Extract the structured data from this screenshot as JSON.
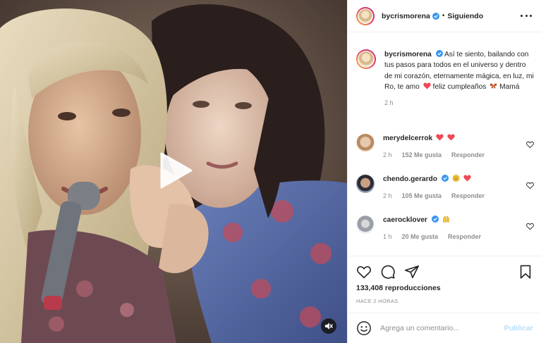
{
  "post": {
    "username": "bycrismorena",
    "follow_label": "Siguiendo",
    "separator": "•",
    "caption_text": "Así te siento, bailando con tus pasos para todos en el universo y dentro de mi corazón, eternamente mágica, en luz, mi Ro, te amo",
    "caption_text_2": "feliz cumpleaños",
    "caption_text_3": "Mamá",
    "caption_time": "2 h",
    "views": "133,408 reproducciones",
    "posted_ago": "HACE 2 HORAS"
  },
  "comments": [
    {
      "username": "merydelcerrok",
      "time": "2 h",
      "likes": "152 Me gusta",
      "reply": "Responder",
      "verified": false
    },
    {
      "username": "chendo.gerardo",
      "time": "2 h",
      "likes": "105 Me gusta",
      "reply": "Responder",
      "verified": true
    },
    {
      "username": "caerocklover",
      "time": "1 h",
      "likes": "20 Me gusta",
      "reply": "Responder",
      "verified": true
    }
  ],
  "add_comment": {
    "placeholder": "Agrega un comentario...",
    "publish_label": "Publicar"
  },
  "icons": {
    "like": "heart-icon",
    "comment": "comment-icon",
    "share": "share-icon",
    "save": "bookmark-icon",
    "emoji": "smile-icon",
    "mute": "speaker-muted-icon",
    "play": "play-icon",
    "more": "more-options-icon"
  },
  "colors": {
    "verified": "#3897f0",
    "heart_red": "#ed4956",
    "publish_disabled": "#b2dffc",
    "muted_text": "#8e8e8e"
  }
}
